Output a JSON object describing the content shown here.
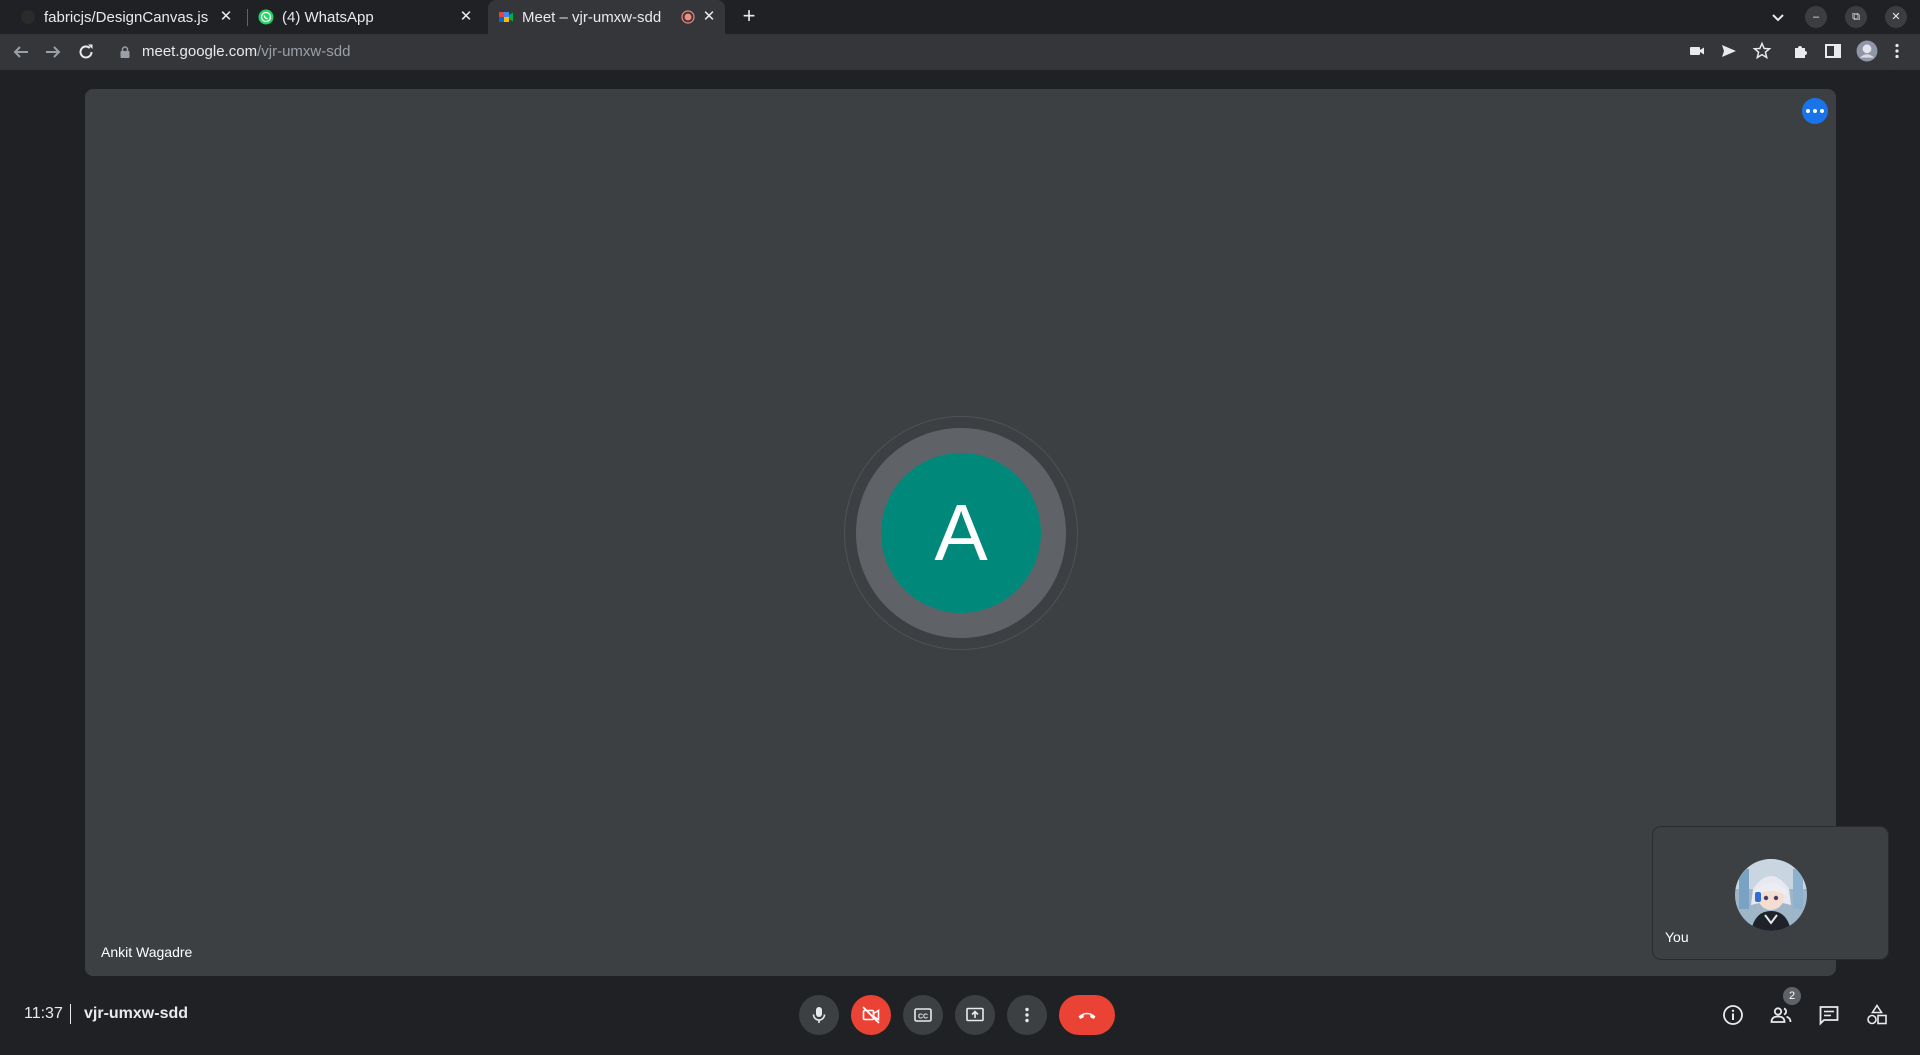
{
  "browser": {
    "tabs": [
      {
        "title": "fabricjs/DesignCanvas.js",
        "icon": "github-icon",
        "active": false
      },
      {
        "title": "(4) WhatsApp",
        "icon": "whatsapp-icon",
        "active": false
      },
      {
        "title": "Meet – vjr-umxw-sdd",
        "icon": "google-meet-icon",
        "active": true,
        "recording": true
      }
    ],
    "url_host": "meet.google.com",
    "url_path": "/vjr-umxw-sdd"
  },
  "meeting": {
    "main_participant_initial": "A",
    "main_participant_name": "Ankit Wagadre",
    "main_avatar_color": "#00897b",
    "self_label": "You",
    "time": "11:37",
    "code": "vjr-umxw-sdd",
    "participant_count": "2"
  },
  "colors": {
    "accent": "#1a73e8",
    "danger": "#ea4335",
    "surface": "#3c4043",
    "background": "#202124"
  },
  "controls": [
    "microphone-icon",
    "camera-off-icon",
    "captions-icon",
    "present-screen-icon",
    "more-options-icon",
    "hang-up-icon"
  ],
  "side_controls": [
    "meeting-details-icon",
    "people-icon",
    "chat-icon",
    "activities-icon"
  ]
}
